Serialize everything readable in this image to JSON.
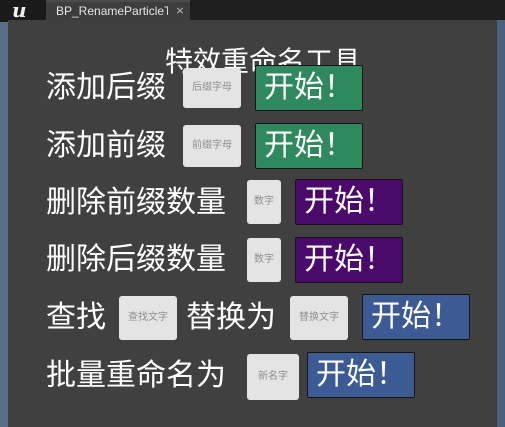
{
  "window": {
    "logo": "u",
    "tab_title": "BP_RenameParticleTc",
    "tab_close": "×"
  },
  "tool": {
    "title": "特效重命名工具",
    "rows": [
      {
        "label": "添加后缀",
        "field_placeholder": "后缀字母",
        "button": "开始！",
        "button_color": "#2e8a5c"
      },
      {
        "label": "添加前缀",
        "field_placeholder": "前缀字母",
        "button": "开始！",
        "button_color": "#2e8a5c"
      },
      {
        "label": "删除前缀数量",
        "field_placeholder": "数字",
        "button": "开始！",
        "button_color": "#4b0a6b"
      },
      {
        "label": "删除后缀数量",
        "field_placeholder": "数字",
        "button": "开始！",
        "button_color": "#4b0a6b"
      },
      {
        "label": "查找",
        "field_placeholder": "查找文字",
        "label2": "替换为",
        "field2_placeholder": "替换文字",
        "button": "开始！",
        "button_color": "#3c5a93"
      },
      {
        "label": "批量重命名为",
        "field_placeholder": "新名字",
        "button": "开始！",
        "button_color": "#3c5a93"
      }
    ]
  }
}
